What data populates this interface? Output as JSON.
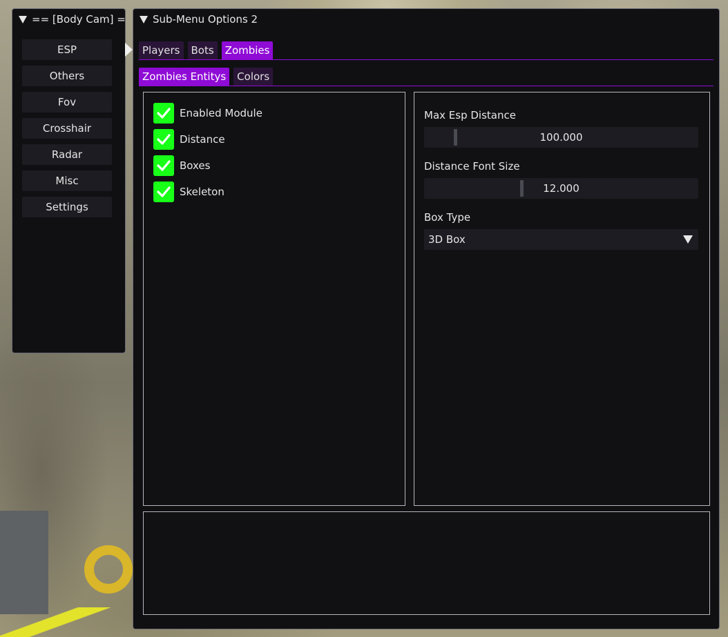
{
  "left_window": {
    "title": "== [Body Cam] ==",
    "items": [
      "ESP",
      "Others",
      "Fov",
      "Crosshair",
      "Radar",
      "Misc",
      "Settings"
    ]
  },
  "right_window": {
    "title": "Sub-Menu Options 2",
    "tabs": [
      {
        "label": "Players",
        "active": false
      },
      {
        "label": "Bots",
        "active": false
      },
      {
        "label": "Zombies",
        "active": true
      }
    ],
    "subtabs": [
      {
        "label": "Zombies Entitys",
        "active": true
      },
      {
        "label": "Colors",
        "active": false
      }
    ],
    "checkboxes": [
      {
        "label": "Enabled Module",
        "checked": true
      },
      {
        "label": "Distance",
        "checked": true
      },
      {
        "label": "Boxes",
        "checked": true
      },
      {
        "label": "Skeleton",
        "checked": true
      }
    ],
    "max_esp_distance": {
      "label": "Max Esp Distance",
      "value": "100.000",
      "fill": 0.1
    },
    "distance_font_size": {
      "label": "Distance Font Size",
      "value": "12.000",
      "fill": 0.35
    },
    "box_type": {
      "label": "Box Type",
      "value": "3D Box"
    }
  },
  "colors": {
    "accent": "#8f0bd6",
    "checkbox": "#18ff18",
    "window_bg": "#101013"
  }
}
